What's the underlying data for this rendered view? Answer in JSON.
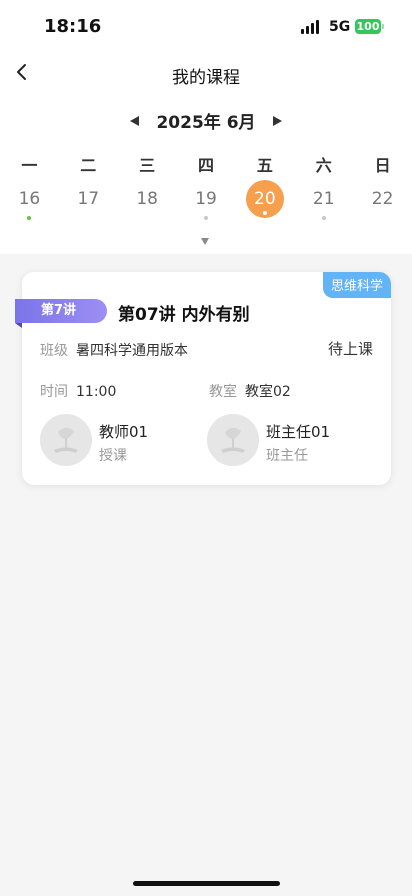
{
  "status_bar": {
    "time": "18:16",
    "network": "5G",
    "battery": "100",
    "battery_color": "#32c75a"
  },
  "nav": {
    "title": "我的课程",
    "back_icon": "chevron-left-icon"
  },
  "calendar": {
    "month_label": "2025年 6月",
    "weekdays": [
      "一",
      "二",
      "三",
      "四",
      "五",
      "六",
      "日"
    ],
    "dates": [
      {
        "day": "16",
        "dot": "green"
      },
      {
        "day": "17",
        "dot": "none"
      },
      {
        "day": "18",
        "dot": "none"
      },
      {
        "day": "19",
        "dot": "gray"
      },
      {
        "day": "20",
        "dot": "white",
        "selected": true
      },
      {
        "day": "21",
        "dot": "gray"
      },
      {
        "day": "22",
        "dot": "none"
      }
    ],
    "selected_color": "#f6a04d"
  },
  "course_card": {
    "subject_tag": "思维科学",
    "lecture_tag": "第7讲",
    "title": "第07讲 内外有别",
    "class_label": "班级",
    "class_value": "暑四科学通用版本",
    "status": "待上课",
    "time_label": "时间",
    "time_value": "11:00",
    "room_label": "教室",
    "room_value": "教室02",
    "teacher": {
      "name": "教师01",
      "role": "授课"
    },
    "head_teacher": {
      "name": "班主任01",
      "role": "班主任"
    }
  }
}
